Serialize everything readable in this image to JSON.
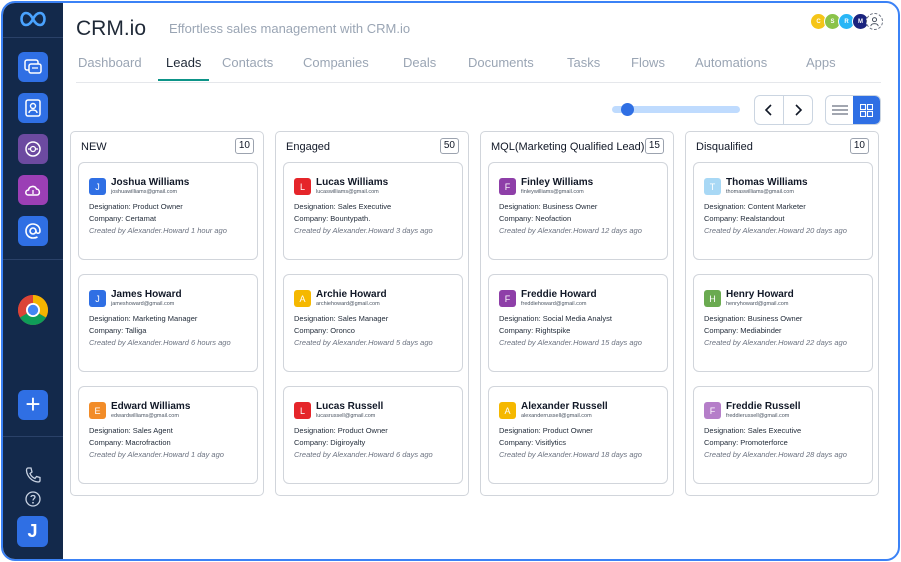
{
  "app": {
    "title": "CRM.io",
    "tagline": "Effortless sales management with CRM.io"
  },
  "presence": [
    {
      "initial": "C",
      "color": "#f5c518"
    },
    {
      "initial": "S",
      "color": "#8bc34a"
    },
    {
      "initial": "R",
      "color": "#29b6f6"
    },
    {
      "initial": "M",
      "color": "#1a237e"
    }
  ],
  "tabs": [
    "Dashboard",
    "Leads",
    "Contacts",
    "Companies",
    "Deals",
    "Documents",
    "Tasks",
    "Flows",
    "Automations",
    "Apps"
  ],
  "active_tab": "Leads",
  "sidebar": {
    "icons": [
      "chat-icon",
      "contact-card-icon",
      "support-icon",
      "cloud-icon",
      "at-sign-icon"
    ],
    "user_initial": "J"
  },
  "toolbar": {
    "prev": "‹",
    "next": "›",
    "zoom_fraction": 0.12
  },
  "columns": [
    {
      "title": "NEW",
      "count": "10",
      "cards": [
        {
          "initial": "J",
          "color": "#2f6fe4",
          "name": "Joshua Williams",
          "email": "joshuawilliams@gmail.com",
          "designation": "Designation: Product Owner",
          "company": "Company: Certamat",
          "created": "Created by Alexander.Howard 1 hour ago"
        },
        {
          "initial": "J",
          "color": "#2f6fe4",
          "name": "James Howard",
          "email": "jameshoward@gmail.com",
          "designation": "Designation: Marketing Manager",
          "company": "Company: Talliga",
          "created": "Created by Alexander.Howard 6 hours ago"
        },
        {
          "initial": "E",
          "color": "#f28c28",
          "name": "Edward Williams",
          "email": "edwardwilliams@gmail.com",
          "designation": "Designation: Sales Agent",
          "company": "Company: Macrofraction",
          "created": "Created by Alexander.Howard 1 day ago"
        }
      ]
    },
    {
      "title": "Engaged",
      "count": "50",
      "cards": [
        {
          "initial": "L",
          "color": "#e5252a",
          "name": "Lucas Williams",
          "email": "lucaswilliams@gmail.com",
          "designation": "Designation: Sales Executive",
          "company": "Company: Bountypath.",
          "created": "Created by Alexander.Howard 3 days ago"
        },
        {
          "initial": "A",
          "color": "#f5b800",
          "name": "Archie Howard",
          "email": "archiehoward@gmail.com",
          "designation": "Designation: Sales Manager",
          "company": "Company: Oronco",
          "created": "Created by Alexander.Howard 5 days ago"
        },
        {
          "initial": "L",
          "color": "#e5252a",
          "name": "Lucas Russell",
          "email": "lucasrussell@gmail.com",
          "designation": "Designation: Product Owner",
          "company": "Company: Digiroyalty",
          "created": "Created by Alexander.Howard 6 days ago"
        }
      ]
    },
    {
      "title": "MQL(Marketing Qualified Lead)",
      "count": "15",
      "cards": [
        {
          "initial": "F",
          "color": "#8e3fa8",
          "name": "Finley Williams",
          "email": "finleywilliams@gmail.com",
          "designation": "Designation: Business Owner",
          "company": "Company: Neofaction",
          "created": "Created by Alexander.Howard 12 days ago"
        },
        {
          "initial": "F",
          "color": "#8e3fa8",
          "name": "Freddie Howard",
          "email": "freddiehoward@gmail.com",
          "designation": "Designation: Social Media Analyst",
          "company": "Company: Rightspike",
          "created": "Created by Alexander.Howard 15 days ago"
        },
        {
          "initial": "A",
          "color": "#f5b800",
          "name": "Alexander Russell",
          "email": "alexanderrussell@gmail.com",
          "designation": "Designation: Product Owner",
          "company": "Company: Visitlytics",
          "created": "Created by Alexander.Howard 18 days ago"
        }
      ]
    },
    {
      "title": "Disqualified",
      "count": "10",
      "cards": [
        {
          "initial": "T",
          "color": "#a8d8f5",
          "name": "Thomas Williams",
          "email": "thomaswilliams@gmail.com",
          "designation": "Designation: Content Marketer",
          "company": "Company: Realstandout",
          "created": "Created by Alexander.Howard 20 days ago"
        },
        {
          "initial": "H",
          "color": "#6aaa50",
          "name": "Henry Howard",
          "email": "henryhoward@gmail.com",
          "designation": "Designation: Business Owner",
          "company": "Company: Mediabinder",
          "created": "Created by Alexander.Howard 22 days ago"
        },
        {
          "initial": "F",
          "color": "#b57ec9",
          "name": "Freddie Russell",
          "email": "freddierussell@gmail.com",
          "designation": "Designation: Sales Executive",
          "company": "Company: Promoterforce",
          "created": "Created by Alexander.Howard 28 days ago"
        }
      ]
    }
  ]
}
